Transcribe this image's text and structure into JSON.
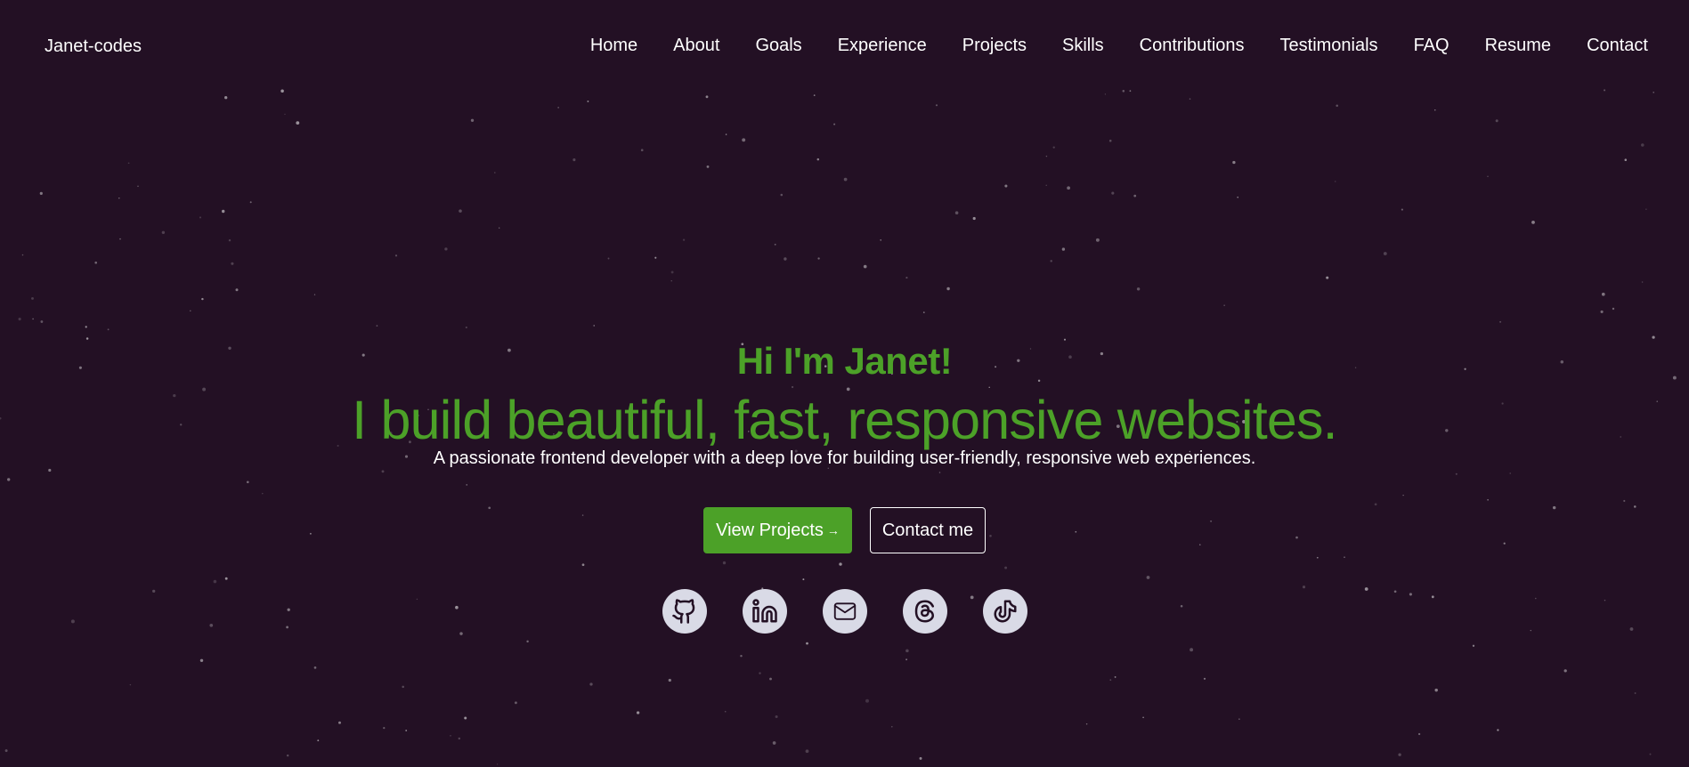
{
  "navbar": {
    "brand": "Janet-codes",
    "links": [
      "Home",
      "About",
      "Goals",
      "Experience",
      "Projects",
      "Skills",
      "Contributions",
      "Testimonials",
      "FAQ",
      "Resume",
      "Contact"
    ]
  },
  "hero": {
    "greeting": "Hi I'm Janet!",
    "headline": "I build beautiful, fast, responsive websites.",
    "subtitle": "A passionate frontend developer with a deep love for building user-friendly, responsive web experiences.",
    "primary_button": "View Projects",
    "primary_button_arrow": "→",
    "secondary_button": "Contact me"
  },
  "socials": [
    {
      "icon": "github-icon"
    },
    {
      "icon": "linkedin-icon"
    },
    {
      "icon": "mail-icon"
    },
    {
      "icon": "threads-icon"
    },
    {
      "icon": "tiktok-icon"
    }
  ],
  "colors": {
    "background": "#231024",
    "accent": "#4ca128",
    "text": "#ffffff",
    "icon_bg": "#d9dae6"
  }
}
